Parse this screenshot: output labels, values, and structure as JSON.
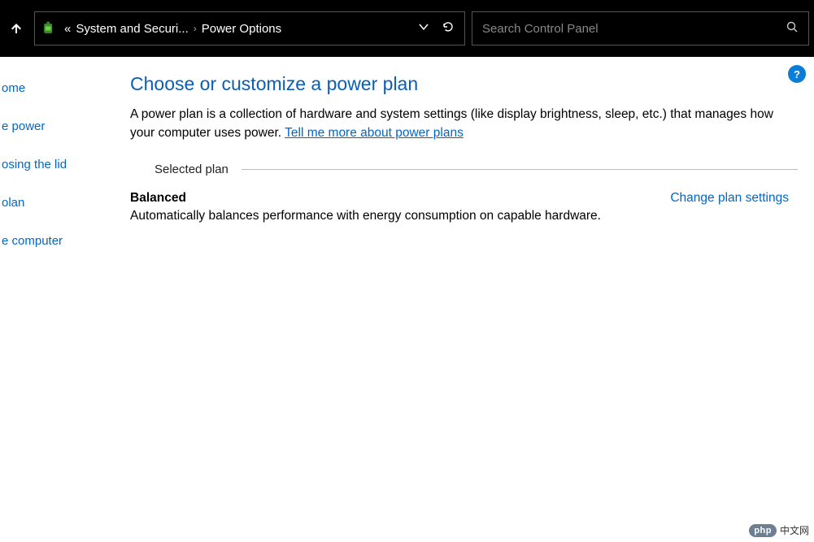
{
  "titlebar": {
    "breadcrumb_prefix": "«",
    "breadcrumb_parent": "System and Securi...",
    "breadcrumb_sep": "›",
    "breadcrumb_current": "Power Options",
    "search_placeholder": "Search Control Panel"
  },
  "sidebar": {
    "items": [
      "ome",
      "e power",
      "osing the lid",
      "olan",
      "e computer"
    ]
  },
  "help": {
    "label": "?"
  },
  "main": {
    "heading": "Choose or customize a power plan",
    "description_part1": "A power plan is a collection of hardware and system settings (like display brightness, sleep, etc.) that manages how your computer uses power. ",
    "description_link": "Tell me more about power plans",
    "section_label": "Selected plan",
    "plan_name": "Balanced",
    "plan_desc": "Automatically balances performance with energy consumption on capable hardware.",
    "change_link": "Change plan settings"
  },
  "watermark": {
    "badge": "php",
    "text": "中文网"
  }
}
